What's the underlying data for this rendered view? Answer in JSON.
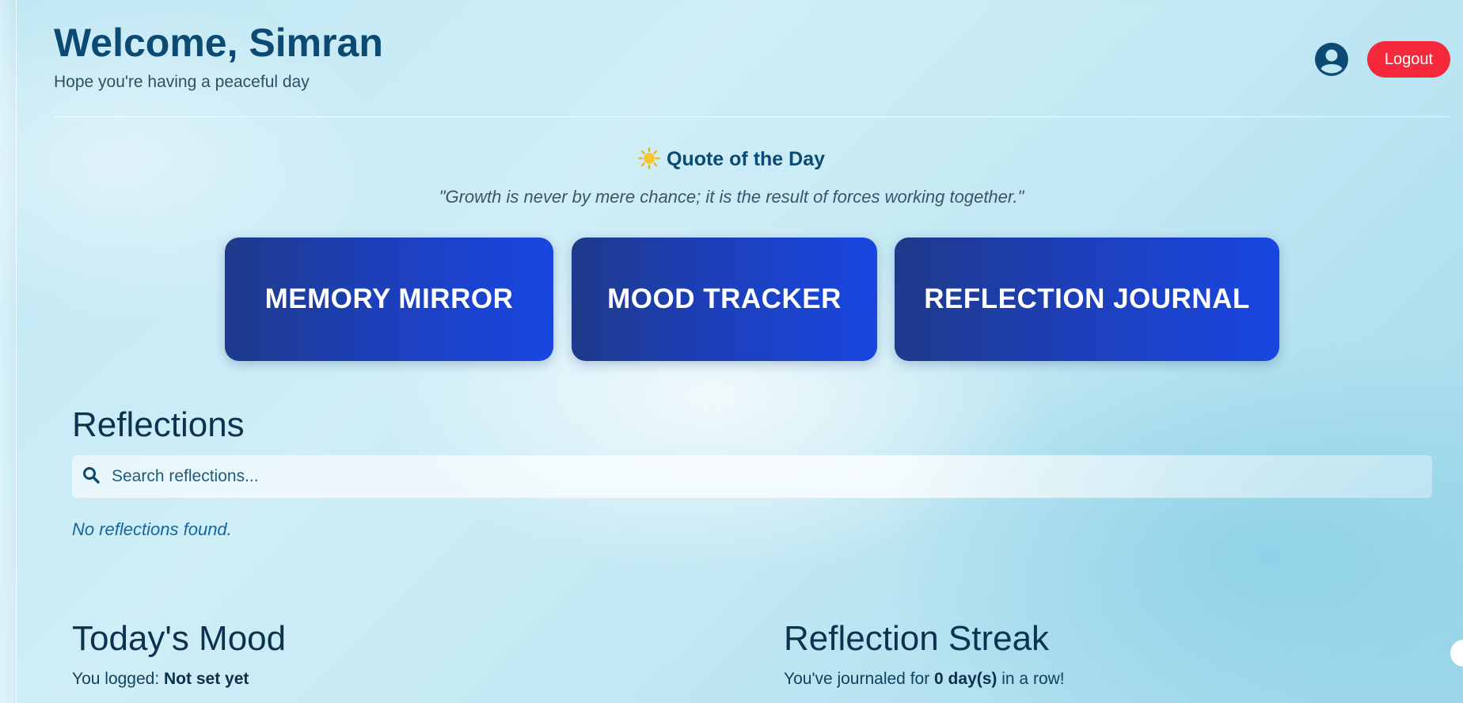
{
  "header": {
    "title": "Welcome, Simran",
    "subtitle": "Hope you're having a peaceful day",
    "logout_label": "Logout",
    "avatar_icon": "user-circle-icon"
  },
  "quote": {
    "icon": "sun-icon",
    "title": "Quote of the Day",
    "text": "\"Growth is never by mere chance; it is the result of forces working together.\""
  },
  "features": [
    {
      "label": "MEMORY MIRROR"
    },
    {
      "label": "MOOD TRACKER"
    },
    {
      "label": "REFLECTION JOURNAL"
    }
  ],
  "reflections": {
    "title": "Reflections",
    "search_placeholder": "Search reflections...",
    "search_icon": "search-icon",
    "empty_message": "No reflections found."
  },
  "mood": {
    "title": "Today's Mood",
    "prefix": "You logged: ",
    "value": "Not set yet"
  },
  "streak": {
    "title": "Reflection Streak",
    "prefix": "You've journaled for ",
    "value": "0 day(s)",
    "suffix": " in a row!"
  },
  "colors": {
    "title": "#0b4a72",
    "logout": "#f5283c",
    "card_start": "#1e3a8a",
    "card_end": "#1846e0"
  }
}
